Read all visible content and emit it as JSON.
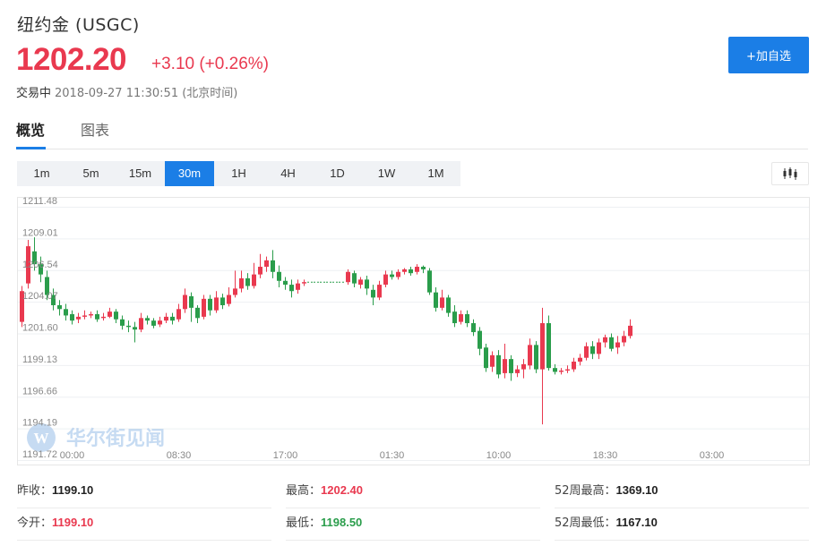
{
  "header": {
    "title": "纽约金 (USGC)",
    "price": "1202.20",
    "change": "+3.10 (+0.26%)",
    "state": "交易中",
    "timestamp": "2018-09-27 11:30:51 (北京时间)",
    "add_button": "+加自选"
  },
  "tabs": [
    {
      "label": "概览",
      "active": true
    },
    {
      "label": "图表",
      "active": false
    }
  ],
  "intervals": [
    {
      "label": "1m",
      "active": false
    },
    {
      "label": "5m",
      "active": false
    },
    {
      "label": "15m",
      "active": false
    },
    {
      "label": "30m",
      "active": true
    },
    {
      "label": "1H",
      "active": false
    },
    {
      "label": "4H",
      "active": false
    },
    {
      "label": "1D",
      "active": false
    },
    {
      "label": "1W",
      "active": false
    },
    {
      "label": "1M",
      "active": false
    }
  ],
  "chart_type_icon": "candlestick-icon",
  "watermark": "华尔街见闻",
  "colors": {
    "up": "#e9394f",
    "down": "#2a9d4b",
    "accent": "#1b7ee6"
  },
  "chart_data": {
    "type": "candlestick",
    "interval": "30m",
    "y_ticks": [
      "1211.48",
      "1209.01",
      "1206.54",
      "1204.07",
      "1201.60",
      "1199.13",
      "1196.66",
      "1194.19",
      "1191.72"
    ],
    "ylim": [
      1191.72,
      1211.48
    ],
    "x_ticks": [
      {
        "label": "00:00",
        "index": 2
      },
      {
        "label": "08:30",
        "index": 19
      },
      {
        "label": "17:00",
        "index": 36
      },
      {
        "label": "01:30",
        "index": 53
      },
      {
        "label": "10:00",
        "index": 70
      },
      {
        "label": "18:30",
        "index": 87
      },
      {
        "label": "03:00",
        "index": 104
      }
    ],
    "candles": [
      [
        1202.5,
        1204.9,
        1205.3,
        1202.1
      ],
      [
        1205.5,
        1208.4,
        1208.9,
        1205.1
      ],
      [
        1208.0,
        1207.0,
        1209.1,
        1206.5
      ],
      [
        1207.0,
        1206.2,
        1207.6,
        1205.6
      ],
      [
        1206.0,
        1204.6,
        1206.5,
        1204.2
      ],
      [
        1204.6,
        1203.8,
        1205.1,
        1203.4
      ],
      [
        1203.8,
        1203.5,
        1204.2,
        1203.0
      ],
      [
        1203.5,
        1203.0,
        1203.9,
        1202.6
      ],
      [
        1203.1,
        1202.6,
        1203.4,
        1202.3
      ],
      [
        1202.7,
        1202.9,
        1203.2,
        1202.4
      ],
      [
        1202.9,
        1203.0,
        1203.4,
        1202.7
      ],
      [
        1203.0,
        1203.1,
        1203.3,
        1202.8
      ],
      [
        1203.1,
        1202.7,
        1203.4,
        1202.5
      ],
      [
        1202.8,
        1202.9,
        1203.2,
        1202.6
      ],
      [
        1202.9,
        1203.3,
        1203.6,
        1202.8
      ],
      [
        1203.3,
        1202.7,
        1203.5,
        1202.4
      ],
      [
        1202.7,
        1202.2,
        1203.0,
        1201.9
      ],
      [
        1202.2,
        1202.1,
        1202.6,
        1201.7
      ],
      [
        1202.1,
        1201.9,
        1202.5,
        1200.9
      ],
      [
        1201.9,
        1202.8,
        1203.2,
        1201.7
      ],
      [
        1202.8,
        1202.6,
        1203.0,
        1202.3
      ],
      [
        1202.6,
        1202.2,
        1202.8,
        1202.0
      ],
      [
        1202.3,
        1202.6,
        1202.9,
        1202.1
      ],
      [
        1202.6,
        1202.9,
        1203.2,
        1202.4
      ],
      [
        1202.9,
        1202.6,
        1203.2,
        1202.3
      ],
      [
        1202.7,
        1203.5,
        1203.9,
        1202.5
      ],
      [
        1203.5,
        1204.6,
        1205.1,
        1203.2
      ],
      [
        1204.5,
        1203.6,
        1204.8,
        1202.5
      ],
      [
        1203.6,
        1202.8,
        1203.8,
        1202.4
      ],
      [
        1202.9,
        1204.3,
        1204.6,
        1202.7
      ],
      [
        1204.3,
        1203.4,
        1204.6,
        1203.0
      ],
      [
        1203.4,
        1204.4,
        1204.9,
        1203.2
      ],
      [
        1204.4,
        1203.8,
        1204.7,
        1203.5
      ],
      [
        1203.9,
        1204.6,
        1205.2,
        1203.7
      ],
      [
        1204.6,
        1205.1,
        1206.5,
        1204.4
      ],
      [
        1205.1,
        1205.9,
        1206.5,
        1204.8
      ],
      [
        1205.9,
        1205.3,
        1206.3,
        1205.0
      ],
      [
        1205.3,
        1206.2,
        1207.1,
        1205.1
      ],
      [
        1206.2,
        1206.8,
        1207.8,
        1205.9
      ],
      [
        1206.8,
        1207.3,
        1207.6,
        1206.4
      ],
      [
        1207.3,
        1206.4,
        1208.1,
        1205.9
      ],
      [
        1206.4,
        1205.7,
        1206.9,
        1205.2
      ],
      [
        1205.7,
        1205.4,
        1206.0,
        1205.0
      ],
      [
        1205.4,
        1204.9,
        1205.8,
        1204.4
      ],
      [
        1205.0,
        1205.5,
        1205.8,
        1204.7
      ],
      [
        1205.5,
        1205.6,
        1205.8,
        1205.3
      ],
      [
        1205.6,
        1205.6,
        1205.6,
        1205.6
      ],
      [
        1205.6,
        1205.6,
        1205.6,
        1205.6
      ],
      [
        1205.6,
        1205.6,
        1205.6,
        1205.6
      ],
      [
        1205.6,
        1205.6,
        1205.6,
        1205.6
      ],
      [
        1205.6,
        1205.6,
        1205.6,
        1205.6
      ],
      [
        1205.6,
        1205.6,
        1205.6,
        1205.6
      ],
      [
        1205.6,
        1206.4,
        1206.6,
        1205.4
      ],
      [
        1206.3,
        1205.5,
        1206.5,
        1205.2
      ],
      [
        1205.4,
        1205.8,
        1206.0,
        1205.1
      ],
      [
        1205.8,
        1205.1,
        1206.1,
        1204.6
      ],
      [
        1205.0,
        1204.4,
        1205.4,
        1203.8
      ],
      [
        1204.4,
        1205.4,
        1205.7,
        1204.2
      ],
      [
        1205.4,
        1206.2,
        1206.5,
        1205.2
      ],
      [
        1206.2,
        1206.0,
        1206.5,
        1205.8
      ],
      [
        1206.0,
        1206.4,
        1206.6,
        1205.8
      ],
      [
        1206.4,
        1206.6,
        1206.7,
        1206.2
      ],
      [
        1206.6,
        1206.3,
        1206.8,
        1206.1
      ],
      [
        1206.4,
        1206.8,
        1207.0,
        1206.2
      ],
      [
        1206.8,
        1206.6,
        1206.9,
        1206.3
      ],
      [
        1206.5,
        1204.8,
        1206.7,
        1204.6
      ],
      [
        1204.8,
        1203.6,
        1205.2,
        1203.3
      ],
      [
        1203.6,
        1204.4,
        1205.0,
        1203.4
      ],
      [
        1204.4,
        1203.2,
        1204.6,
        1202.9
      ],
      [
        1203.3,
        1202.4,
        1203.8,
        1202.1
      ],
      [
        1202.5,
        1203.1,
        1203.4,
        1202.3
      ],
      [
        1203.1,
        1202.4,
        1203.4,
        1202.1
      ],
      [
        1202.4,
        1201.7,
        1202.7,
        1201.4
      ],
      [
        1201.8,
        1200.4,
        1202.1,
        1199.9
      ],
      [
        1200.5,
        1198.9,
        1200.8,
        1198.6
      ],
      [
        1199.0,
        1199.9,
        1200.2,
        1198.6
      ],
      [
        1199.9,
        1198.4,
        1200.3,
        1198.1
      ],
      [
        1198.5,
        1199.6,
        1200.8,
        1198.1
      ],
      [
        1199.6,
        1198.5,
        1199.9,
        1197.9
      ],
      [
        1198.5,
        1198.8,
        1199.1,
        1198.2
      ],
      [
        1198.8,
        1199.2,
        1199.6,
        1198.1
      ],
      [
        1199.1,
        1200.7,
        1201.2,
        1198.8
      ],
      [
        1200.7,
        1198.8,
        1201.0,
        1198.5
      ],
      [
        1198.8,
        1202.4,
        1203.6,
        1194.5
      ],
      [
        1202.4,
        1198.9,
        1203.0,
        1198.7
      ],
      [
        1198.9,
        1198.6,
        1199.2,
        1198.4
      ],
      [
        1198.6,
        1198.7,
        1198.9,
        1198.4
      ],
      [
        1198.7,
        1198.8,
        1199.1,
        1198.5
      ],
      [
        1198.8,
        1199.4,
        1199.7,
        1198.6
      ],
      [
        1199.4,
        1199.7,
        1200.0,
        1199.1
      ],
      [
        1199.7,
        1200.6,
        1200.9,
        1199.5
      ],
      [
        1200.6,
        1200.0,
        1201.0,
        1199.6
      ],
      [
        1200.0,
        1200.9,
        1201.2,
        1199.6
      ],
      [
        1200.9,
        1201.3,
        1201.5,
        1200.5
      ],
      [
        1201.3,
        1200.4,
        1201.6,
        1200.2
      ],
      [
        1200.5,
        1200.9,
        1201.4,
        1200.0
      ],
      [
        1200.9,
        1201.4,
        1201.8,
        1200.6
      ],
      [
        1201.4,
        1202.2,
        1202.7,
        1201.2
      ]
    ]
  },
  "stats": [
    {
      "label": "昨收：",
      "value": "1199.10",
      "color": "neutral"
    },
    {
      "label": "最高：",
      "value": "1202.40",
      "color": "up"
    },
    {
      "label": "52周最高：",
      "value": "1369.10",
      "color": "neutral"
    },
    {
      "label": "今开：",
      "value": "1199.10",
      "color": "up"
    },
    {
      "label": "最低：",
      "value": "1198.50",
      "color": "down"
    },
    {
      "label": "52周最低：",
      "value": "1167.10",
      "color": "neutral"
    }
  ]
}
